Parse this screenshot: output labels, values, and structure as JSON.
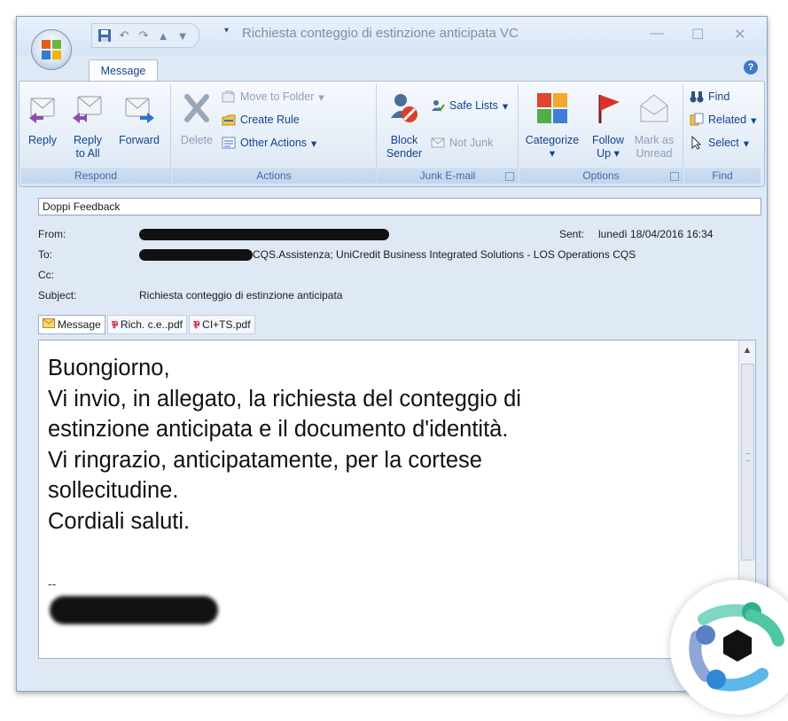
{
  "window": {
    "title": "Richiesta conteggio di estinzione anticipata VC",
    "tab_message": "Message",
    "help": "?"
  },
  "ribbon": {
    "respond": {
      "label": "Respond",
      "reply": "Reply",
      "reply_all_1": "Reply",
      "reply_all_2": "to All",
      "forward": "Forward"
    },
    "actions": {
      "label": "Actions",
      "delete": "Delete",
      "move_to_folder": "Move to Folder",
      "create_rule": "Create Rule",
      "other_actions": "Other Actions"
    },
    "junk": {
      "label": "Junk E-mail",
      "block_sender_1": "Block",
      "block_sender_2": "Sender",
      "safe_lists": "Safe Lists",
      "not_junk": "Not Junk"
    },
    "options": {
      "label": "Options",
      "categorize": "Categorize",
      "follow_up_1": "Follow",
      "follow_up_2": "Up",
      "mark_as_1": "Mark as",
      "mark_as_2": "Unread"
    },
    "find": {
      "label": "Find",
      "find": "Find",
      "related": "Related",
      "select": "Select"
    }
  },
  "header": {
    "info": "Doppi Feedback",
    "from_label": "From:",
    "to_label": "To:",
    "cc_label": "Cc:",
    "subject_label": "Subject:",
    "to_value": "CQS.Assistenza; UniCredit Business Integrated Solutions - LOS Operations CQS",
    "subject_value": "Richiesta conteggio di estinzione anticipata",
    "sent_label": "Sent:",
    "sent_value": "lunedì 18/04/2016 16:34"
  },
  "attachments": [
    {
      "label": "Message"
    },
    {
      "label": "Rich. c.e..pdf"
    },
    {
      "label": "CI+TS.pdf"
    }
  ],
  "body": {
    "lines": [
      "Buongiorno,",
      "Vi invio, in allegato, la richiesta del conteggio di",
      "estinzione anticipata e il documento d'identità.",
      "Vi ringrazio, anticipatamente, per la cortese",
      "sollecitudine.",
      "Cordiali saluti."
    ],
    "signature_sep": "--"
  },
  "colors": {
    "ribbon_text": "#15428b",
    "group_label": "#3e6aaa",
    "frame": "#dfe9f5"
  }
}
